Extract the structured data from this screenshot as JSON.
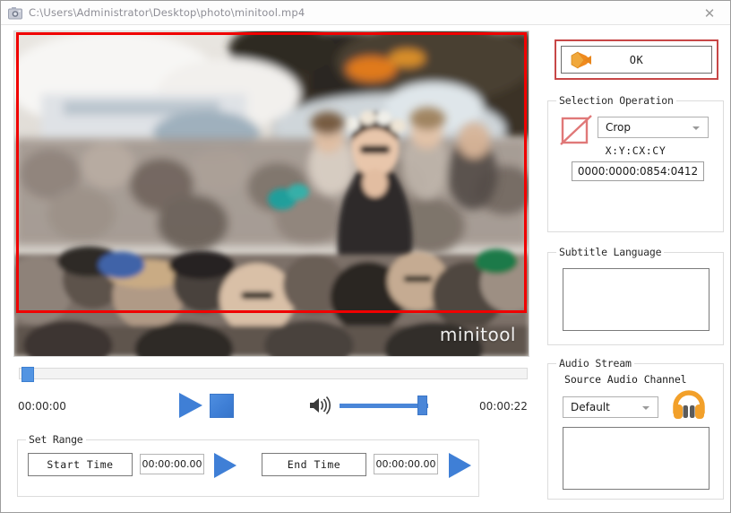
{
  "window": {
    "title": "C:\\Users\\Administrator\\Desktop\\photo\\minitool.mp4",
    "app_icon": "camera-icon",
    "close_label": "✕"
  },
  "video": {
    "watermark": "minitool",
    "crop_overlay_color": "#f00000",
    "scene": "blurred outdoor crowd at a festival"
  },
  "transport": {
    "current_time": "00:00:00",
    "total_time": "00:00:22",
    "play_icon": "play-icon",
    "stop_icon": "stop-icon",
    "speaker_icon": "speaker-icon",
    "seek_position_percent": 0,
    "volume_percent": 100
  },
  "set_range": {
    "legend": "Set Range",
    "start_button": "Start Time",
    "start_value": "00:00:00.00",
    "end_button": "End Time",
    "end_value": "00:00:00.00",
    "preview_icon": "play-icon"
  },
  "ok": {
    "label": "OK",
    "icon": "orange-arrow-icon",
    "focus_color": "#c74747"
  },
  "selection_operation": {
    "legend": "Selection Operation",
    "icon": "crop-icon",
    "mode": "Crop",
    "coords_label": "X:Y:CX:CY",
    "coords_value": "0000:0000:0854:0412"
  },
  "subtitle_language": {
    "legend": "Subtitle Language",
    "items": []
  },
  "audio_stream": {
    "legend": "Audio Stream",
    "source_label": "Source Audio Channel",
    "channel": "Default",
    "icon": "headphones-icon",
    "items": []
  },
  "colors": {
    "accent_blue": "#3f7fd6",
    "accent_orange": "#f59a28",
    "crop_red": "#f00000"
  }
}
